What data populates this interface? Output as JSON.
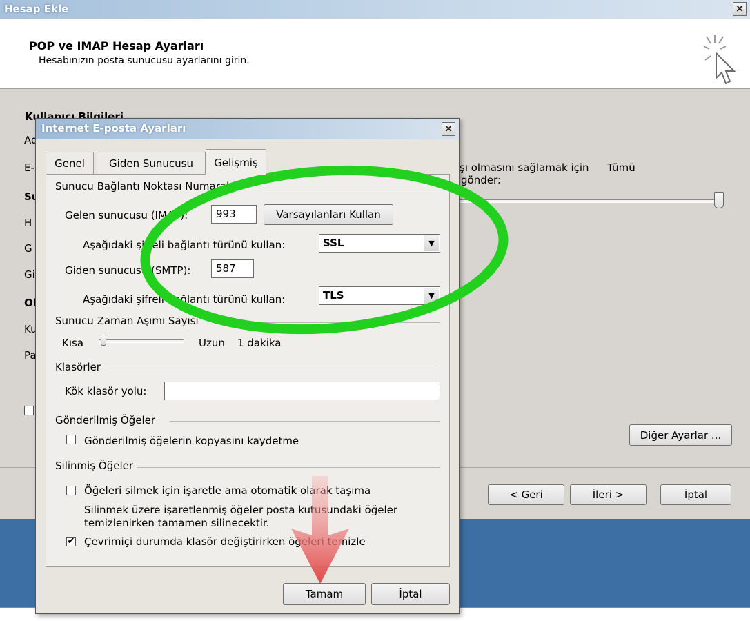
{
  "outer": {
    "title": "Hesap Ekle",
    "close": "×",
    "header_title": "POP ve IMAP Hesap Ayarları",
    "header_subtitle": "Hesabınızın posta sunucusu ayarlarını girin.",
    "section_user_info": "Kullanıcı Bilgileri",
    "left_labels": [
      "Ad",
      "E-",
      "Su",
      "H",
      "G",
      "Gi",
      "Ol",
      "Ku",
      "Pa"
    ],
    "right_text_1": "şı olmasını sağlamak için",
    "right_text_2": "gönder:",
    "right_text_3": "Tümü",
    "other_settings_button": "Diğer Ayarlar ...",
    "back_button": "< Geri",
    "next_button": "İleri >",
    "cancel_button": "İptal"
  },
  "dialog": {
    "title": "Internet E-posta Ayarları",
    "close": "×",
    "tabs": [
      {
        "label": "Genel"
      },
      {
        "label": "Giden Sunucusu"
      },
      {
        "label": "Gelişmiş"
      }
    ],
    "ports_group": "Sunucu Bağlantı Noktası Numaraları",
    "incoming_label": "Gelen sunucusu (IMAP):",
    "incoming_port": "993",
    "defaults_button": "Varsayılanları Kullan",
    "enc_label_1": "Aşağıdaki şifreli bağlantı türünü kullan:",
    "enc_value_1": "SSL",
    "outgoing_label": "Giden sunucusu (SMTP):",
    "outgoing_port": "587",
    "enc_label_2": "Aşağıdaki şifreli bağlantı türünü kullan:",
    "enc_value_2": "TLS",
    "timeout_group": "Sunucu Zaman Aşımı Sayısı",
    "timeout_short": "Kısa",
    "timeout_long": "Uzun",
    "timeout_value": "1 dakika",
    "timeout_level": 0.05,
    "folders_group": "Klasörler",
    "root_folder_label": "Kök klasör yolu:",
    "root_folder_value": "",
    "sent_group": "Gönderilmiş Öğeler",
    "sent_checkbox_label": "Gönderilmiş öğelerin kopyasını kaydetme",
    "deleted_group": "Silinmiş Öğeler",
    "deleted_checkbox_label": "Öğeleri silmek için işaretle ama otomatik olarak taşıma",
    "deleted_note_1": "Silinmek üzere işaretlenmiş öğeler posta kutusundaki öğeler",
    "deleted_note_2": "temizlenirken tamamen silinecektir.",
    "purge_checkbox_label": "Çevrimiçi durumda klasör değiştirirken öğeleri temizle",
    "purge_checked": true,
    "ok_button": "Tamam",
    "cancel_button": "İptal"
  },
  "colors": {
    "highlight_ellipse": "#22d11e",
    "arrow": "#e04848",
    "bottom_band": "#3d6fa4"
  }
}
